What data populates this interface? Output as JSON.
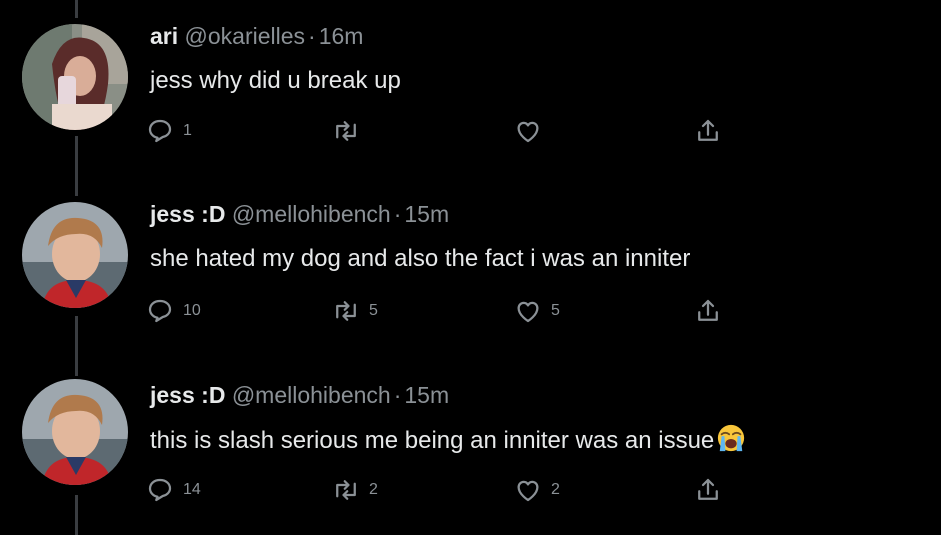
{
  "tweets": [
    {
      "name": "ari",
      "handle": "@okarielles",
      "separator": "·",
      "time": "16m",
      "text": "jess why did u break up",
      "emoji": "",
      "avatar_icon": "avatar-photo-girl",
      "reply_count": "1",
      "retweet_count": "",
      "like_count": "",
      "share_icon": "share-icon"
    },
    {
      "name": "jess :D",
      "handle": "@mellohibench",
      "separator": "·",
      "time": "15m",
      "text": "she hated my dog and also the fact i was an inniter",
      "emoji": "",
      "avatar_icon": "avatar-photo-boy",
      "reply_count": "10",
      "retweet_count": "5",
      "like_count": "5",
      "share_icon": "share-icon"
    },
    {
      "name": "jess :D",
      "handle": "@mellohibench",
      "separator": "·",
      "time": "15m",
      "text": "this is slash serious me being an inniter was an issue",
      "emoji": "loudly-crying-face",
      "avatar_icon": "avatar-photo-boy",
      "reply_count": "14",
      "retweet_count": "2",
      "like_count": "2",
      "share_icon": "share-icon"
    }
  ],
  "colors": {
    "background": "#000000",
    "text": "#e7e9ea",
    "secondary": "#8b9196",
    "thread_line": "#3a3d41"
  }
}
